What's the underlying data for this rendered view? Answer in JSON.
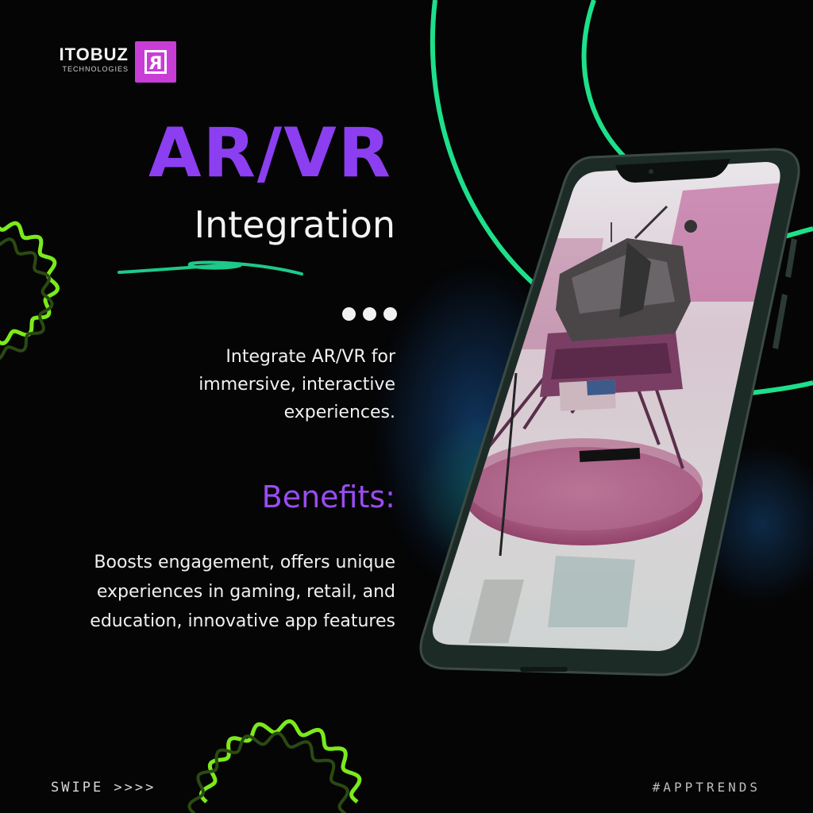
{
  "brand": {
    "name": "ITOBUZ",
    "tagline": "TECHNOLOGIES",
    "logo_icon": "logo-mark-icon",
    "color": "#c83dd6"
  },
  "heading": {
    "title": "AR/VR",
    "subtitle": "Integration"
  },
  "intro": {
    "text": "Integrate AR/VR for immersive, interactive experiences."
  },
  "benefits": {
    "title": "Benefits:",
    "text": "Boosts engagement, offers unique experiences in gaming, retail, and education, innovative app features"
  },
  "footer": {
    "swipe": "SWIPE >>>>",
    "hashtag": "#APPTRENDS"
  },
  "colors": {
    "accent_purple": "#8c3ff0",
    "accent_green": "#1ee08a",
    "accent_lime": "#7bea1c",
    "background": "#050506"
  },
  "phone": {
    "icon": "smartphone-icon",
    "screen_content": "lunar-module-ar-model"
  }
}
